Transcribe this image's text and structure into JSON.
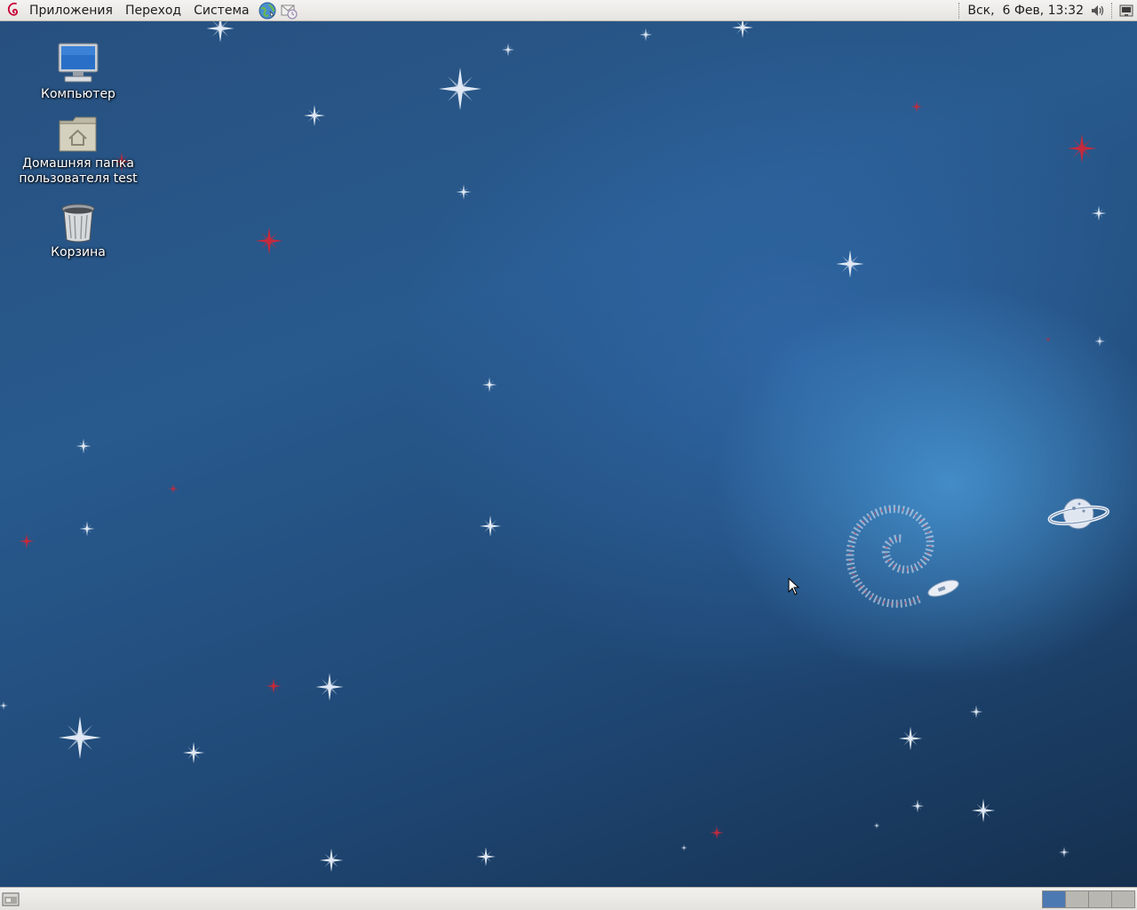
{
  "top_panel": {
    "menus": [
      "Приложения",
      "Переход",
      "Система"
    ],
    "clock": "Вск,  6 Фев, 13:32",
    "launchers": [
      "web-browser-icon",
      "mail-client-icon"
    ],
    "tray": [
      "volume-icon",
      "network-icon"
    ]
  },
  "desktop": {
    "icons": [
      {
        "label": "Компьютер",
        "icon": "computer-icon"
      },
      {
        "label": "Домашняя папка\nпользователя test",
        "label_line1": "Домашняя папка",
        "label_line2": "пользователя test",
        "icon": "home-folder-icon"
      },
      {
        "label": "Корзина",
        "icon": "trash-icon"
      }
    ]
  },
  "bottom_panel": {
    "workspaces": 4,
    "active_workspace": 1
  },
  "colors": {
    "panel": "#e8e6e2",
    "desktop_dark": "#15304f",
    "desktop_mid": "#285a8e",
    "desktop_glow": "#4896d2",
    "active_workspace": "#4d79b3"
  }
}
